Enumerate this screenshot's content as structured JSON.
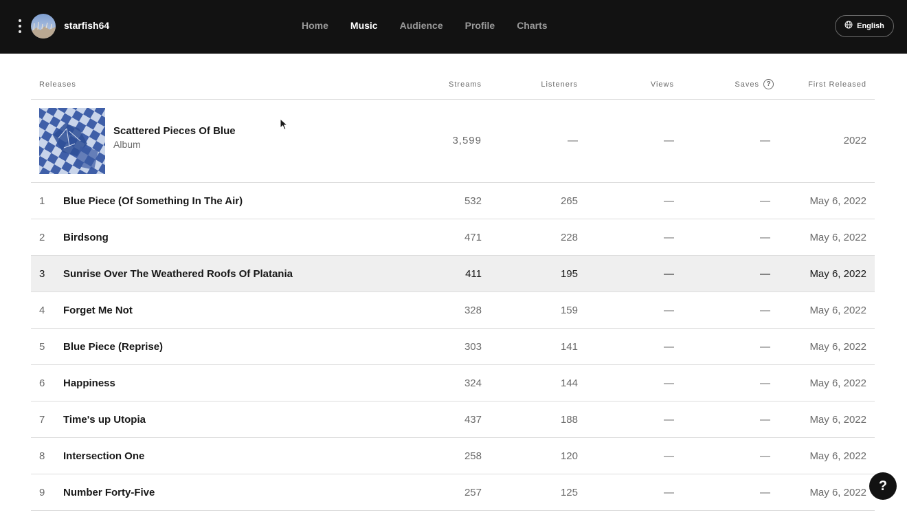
{
  "header": {
    "username": "starfish64",
    "tabs": [
      {
        "label": "Home",
        "active": false
      },
      {
        "label": "Music",
        "active": true
      },
      {
        "label": "Audience",
        "active": false
      },
      {
        "label": "Profile",
        "active": false
      },
      {
        "label": "Charts",
        "active": false
      }
    ],
    "language": "English",
    "language_icon": "globe-icon",
    "menu_icon": "kebab-menu-icon"
  },
  "table": {
    "columns": {
      "releases": "Releases",
      "streams": "Streams",
      "listeners": "Listeners",
      "views": "Views",
      "saves": "Saves",
      "first_released": "First Released"
    },
    "album": {
      "title": "Scattered Pieces Of Blue",
      "type": "Album",
      "streams": "3,599",
      "listeners": "—",
      "views": "—",
      "saves": "—",
      "first_released": "2022"
    },
    "tracks": [
      {
        "num": "1",
        "title": "Blue Piece (Of Something In The Air)",
        "streams": "532",
        "listeners": "265",
        "views": "—",
        "saves": "—",
        "first_released": "May 6, 2022"
      },
      {
        "num": "2",
        "title": "Birdsong",
        "streams": "471",
        "listeners": "228",
        "views": "—",
        "saves": "—",
        "first_released": "May 6, 2022"
      },
      {
        "num": "3",
        "title": "Sunrise Over The Weathered Roofs Of Platania",
        "streams": "411",
        "listeners": "195",
        "views": "—",
        "saves": "—",
        "first_released": "May 6, 2022"
      },
      {
        "num": "4",
        "title": "Forget Me Not",
        "streams": "328",
        "listeners": "159",
        "views": "—",
        "saves": "—",
        "first_released": "May 6, 2022"
      },
      {
        "num": "5",
        "title": "Blue Piece (Reprise)",
        "streams": "303",
        "listeners": "141",
        "views": "—",
        "saves": "—",
        "first_released": "May 6, 2022"
      },
      {
        "num": "6",
        "title": "Happiness",
        "streams": "324",
        "listeners": "144",
        "views": "—",
        "saves": "—",
        "first_released": "May 6, 2022"
      },
      {
        "num": "7",
        "title": "Time's up Utopia",
        "streams": "437",
        "listeners": "188",
        "views": "—",
        "saves": "—",
        "first_released": "May 6, 2022"
      },
      {
        "num": "8",
        "title": "Intersection One",
        "streams": "258",
        "listeners": "120",
        "views": "—",
        "saves": "—",
        "first_released": "May 6, 2022"
      },
      {
        "num": "9",
        "title": "Number Forty-Five",
        "streams": "257",
        "listeners": "125",
        "views": "—",
        "saves": "—",
        "first_released": "May 6, 2022"
      }
    ]
  },
  "help_button": {
    "label": "?",
    "icon": "help-icon"
  },
  "colors": {
    "topbar": "#121212",
    "highlight_row": "#efefef",
    "divider": "#dcdcdc",
    "muted_text": "#6a6a6a"
  }
}
